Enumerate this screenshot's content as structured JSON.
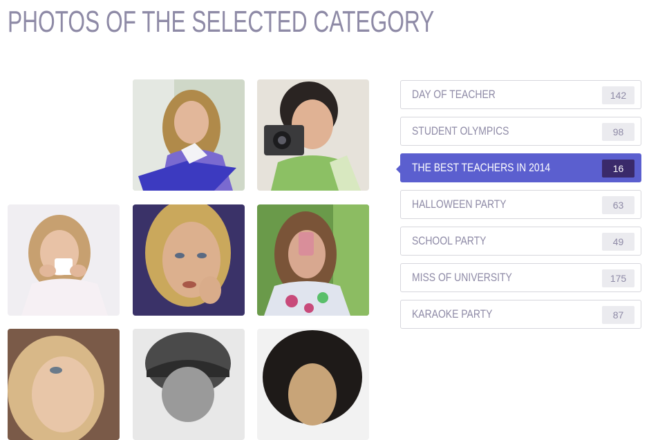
{
  "page": {
    "title": "PHOTOS OF THE SELECTED CATEGORY"
  },
  "categories": [
    {
      "label": "DAY OF TEACHER",
      "count": "142",
      "active": false
    },
    {
      "label": "STUDENT OLYMPICS",
      "count": "98",
      "active": false
    },
    {
      "label": "THE BEST TEACHERS IN 2014",
      "count": "16",
      "active": true
    },
    {
      "label": "HALLOWEEN PARTY",
      "count": "63",
      "active": false
    },
    {
      "label": "SCHOOL PARTY",
      "count": "49",
      "active": false
    },
    {
      "label": "MISS OF UNIVERSITY",
      "count": "175",
      "active": false
    },
    {
      "label": "KARAOKE PARTY",
      "count": "87",
      "active": false
    }
  ],
  "colors": {
    "accent": "#5b5fcf",
    "accent_dark": "#3a2a6a",
    "text": "#8e8aa6",
    "border": "#d6d6dc"
  }
}
